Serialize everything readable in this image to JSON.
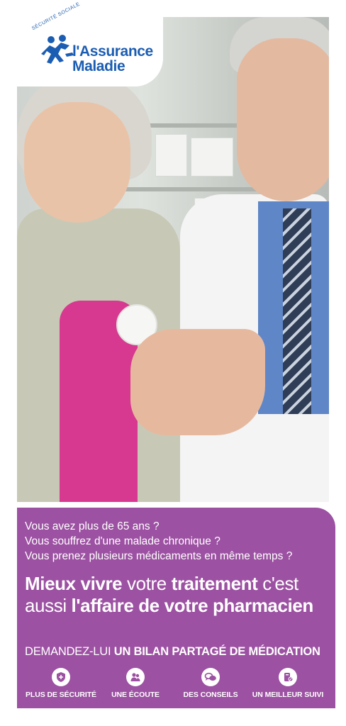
{
  "brand": {
    "name_line1": "l'Assurance",
    "name_line2": "Maladie",
    "arc_text": "SÉCURITÉ SOCIALE",
    "color": "#1b5db2"
  },
  "photo": {
    "icon": "pharmacist-with-patient-photo"
  },
  "panel": {
    "background": "#9c51a2",
    "questions": [
      "Vous avez plus de 65 ans ?",
      "Vous souffrez d'une malade chronique ?",
      "Vous prenez plusieurs médicaments en même temps ?"
    ],
    "headline": {
      "l1_bold1": "Mieux vivre",
      "l1_regular1": " votre ",
      "l1_bold2": "traitement",
      "l1_regular2": " c'est",
      "l2_regular": "aussi ",
      "l2_bold": "l'affaire de votre pharmacien"
    },
    "ask": {
      "regular": "DEMANDEZ-LUI ",
      "bold": "UN BILAN PARTAGÉ DE MÉDICATION"
    },
    "benefits": [
      {
        "label": "PLUS DE SÉCURITÉ",
        "icon": "shield-icon"
      },
      {
        "label": "UNE ÉCOUTE",
        "icon": "people-icon"
      },
      {
        "label": "DES CONSEILS",
        "icon": "speech-bubbles-icon"
      },
      {
        "label": "UN MEILLEUR SUIVI",
        "icon": "pill-box-icon"
      }
    ]
  }
}
